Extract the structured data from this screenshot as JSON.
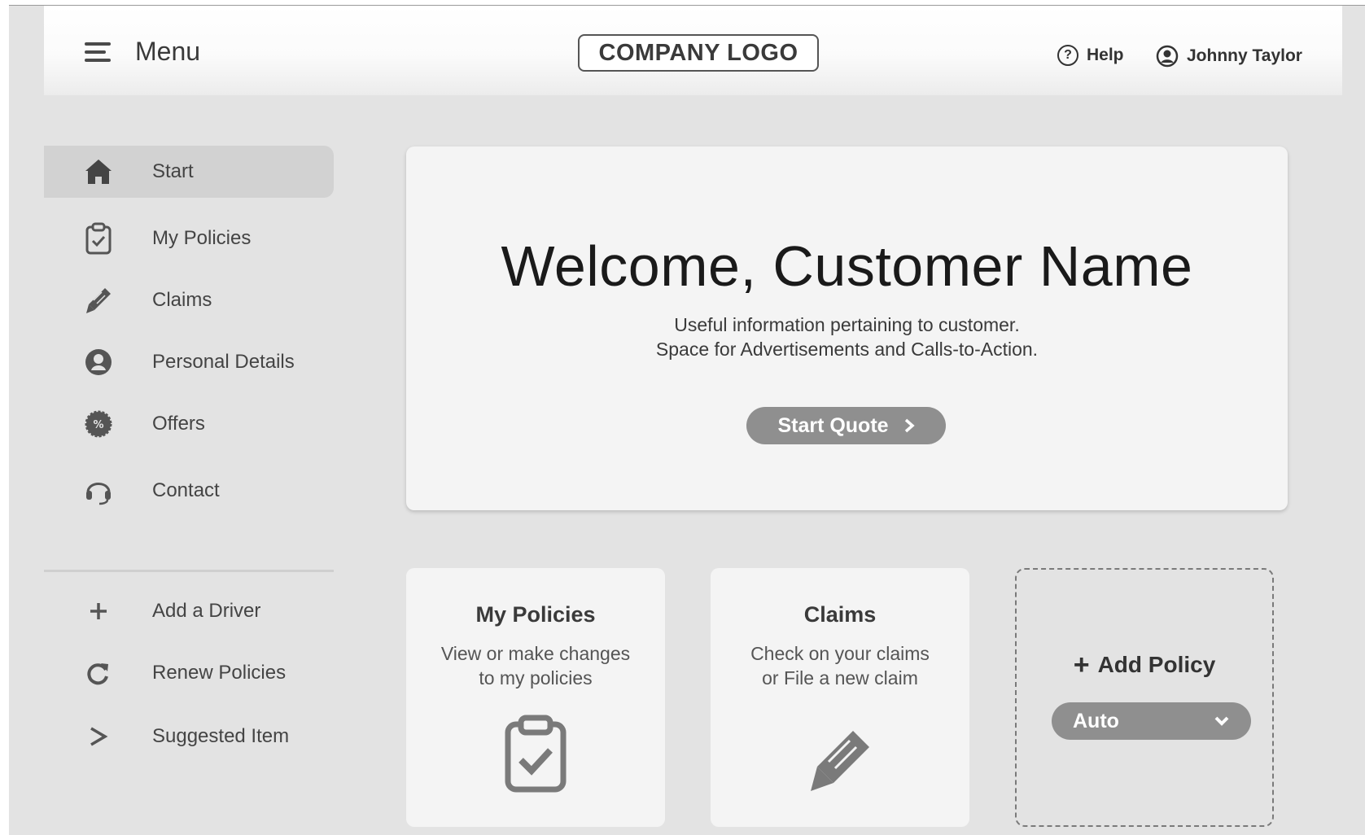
{
  "header": {
    "menu_label": "Menu",
    "logo_text": "COMPANY LOGO",
    "help_label": "Help",
    "user_name": "Johnny Taylor"
  },
  "sidebar": {
    "items": [
      {
        "label": "Start",
        "icon": "home-icon",
        "active": true
      },
      {
        "label": "My Policies",
        "icon": "clipboard-check-icon"
      },
      {
        "label": "Claims",
        "icon": "pencil-icon"
      },
      {
        "label": "Personal Details",
        "icon": "person-circle-icon"
      },
      {
        "label": "Offers",
        "icon": "percent-badge-icon"
      },
      {
        "label": "Contact",
        "icon": "headset-icon"
      }
    ],
    "secondary_items": [
      {
        "label": "Add a Driver",
        "icon": "plus-icon"
      },
      {
        "label": "Renew Policies",
        "icon": "refresh-icon"
      },
      {
        "label": "Suggested Item",
        "icon": "chevron-right-icon"
      }
    ]
  },
  "welcome": {
    "title": "Welcome, Customer Name",
    "line1": "Useful information pertaining to customer.",
    "line2": "Space for Advertisements and Calls-to-Action.",
    "cta_label": "Start Quote"
  },
  "cards": {
    "policies": {
      "title": "My Policies",
      "sub1": "View or make changes",
      "sub2": "to my policies"
    },
    "claims": {
      "title": "Claims",
      "sub1": "Check on your claims",
      "sub2": "or File a new claim"
    },
    "add_policy": {
      "label": "Add Policy",
      "select_value": "Auto"
    }
  },
  "colors": {
    "background": "#e3e3e3",
    "card": "#f4f4f4",
    "button": "#8f8f8f",
    "active_nav": "#d2d2d2"
  }
}
